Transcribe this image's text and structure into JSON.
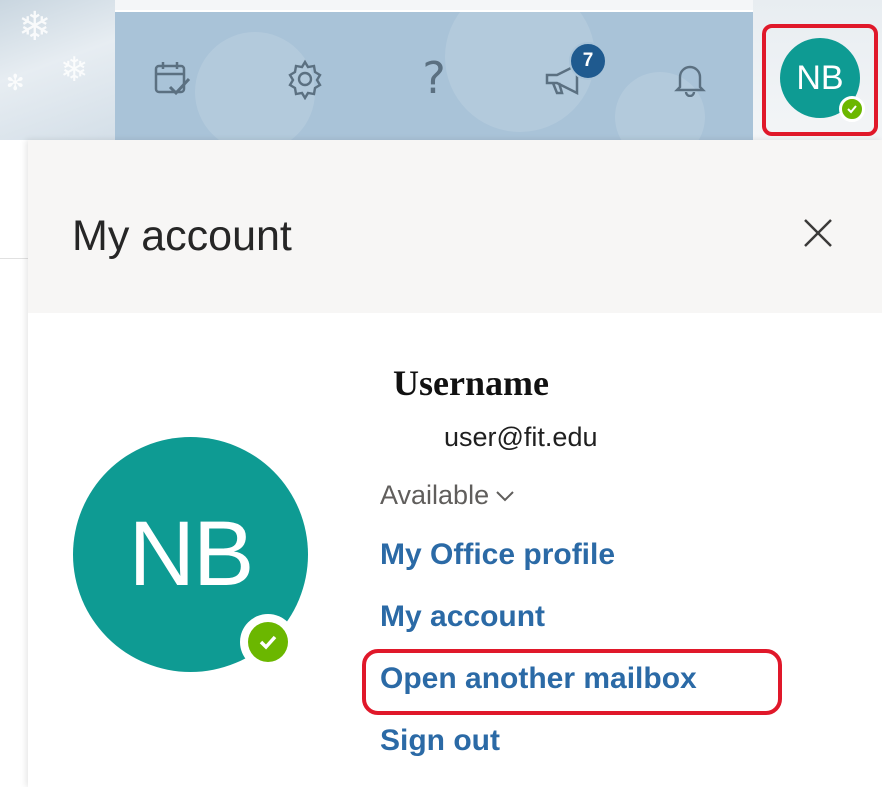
{
  "header": {
    "notifications_badge_count": "7",
    "avatar_initials": "NB",
    "icons": [
      "calendar-check-icon",
      "gear-icon",
      "help-icon",
      "megaphone-icon",
      "bell-icon"
    ]
  },
  "panel": {
    "title": "My account",
    "avatar_initials": "NB",
    "username": "Username",
    "email": "user@fit.edu",
    "presence": "Available",
    "links": {
      "office_profile": "My Office profile",
      "my_account": "My account",
      "open_mailbox": "Open another mailbox",
      "sign_out": "Sign out"
    }
  },
  "colors": {
    "avatar": "#0e9b93",
    "status_available": "#6bb700",
    "link": "#2b6aa6",
    "highlight": "#e0182a",
    "toolbar": "#a9c3d8"
  }
}
